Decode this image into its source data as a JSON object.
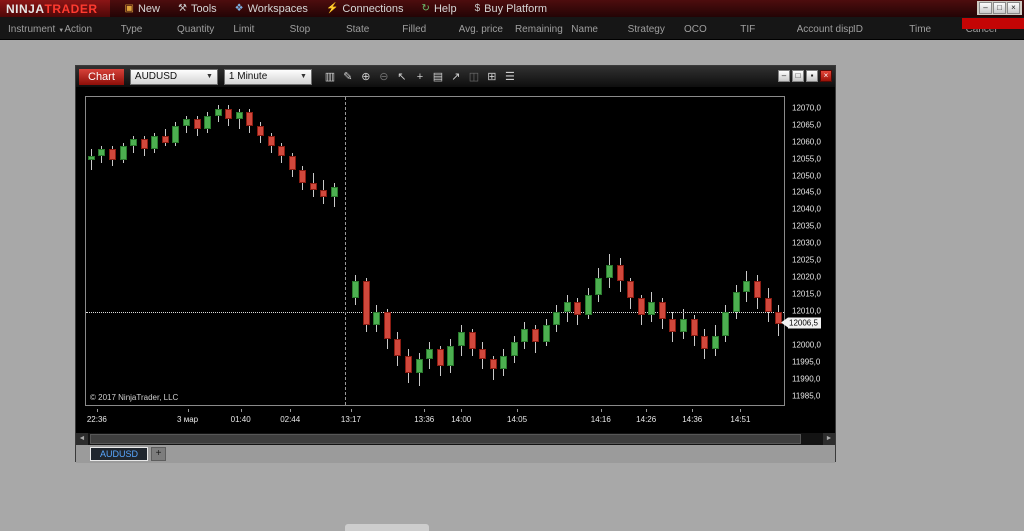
{
  "window": {
    "logo": {
      "part1": "NINJA",
      "part2": "TRADER"
    },
    "controls": [
      {
        "name": "window-minimize-button",
        "glyph": "–"
      },
      {
        "name": "window-restore-button",
        "glyph": "□"
      },
      {
        "name": "window-close-button",
        "glyph": "×"
      }
    ]
  },
  "menu_bar": {
    "items": [
      {
        "label": "New",
        "icon": "new-window-icon",
        "glyph": "▣",
        "color": "#e0a43c"
      },
      {
        "label": "Tools",
        "icon": "tools-icon",
        "glyph": "⚒",
        "color": "#c9c9c9"
      },
      {
        "label": "Workspaces",
        "icon": "workspaces-icon",
        "glyph": "❖",
        "color": "#7fb2e5"
      },
      {
        "label": "Connections",
        "icon": "connections-icon",
        "glyph": "⚡",
        "color": "#e05a4a"
      },
      {
        "label": "Help",
        "icon": "help-refresh-icon",
        "glyph": "↻",
        "color": "#6fc06f"
      },
      {
        "label": "Buy Platform",
        "icon": "dollar-icon",
        "glyph": "$",
        "color": "#c9c9c9"
      }
    ]
  },
  "order_grid": {
    "columns": [
      "Instrument",
      "Action",
      "Type",
      "Quantity",
      "Limit",
      "Stop",
      "State",
      "Filled",
      "Avg. price",
      "Remaining",
      "Name",
      "Strategy",
      "OCO",
      "TIF",
      "Account displ",
      "ID",
      "Time",
      "Cancel"
    ]
  },
  "chart_window": {
    "tab_label": "Chart",
    "instrument": "AUDUSD",
    "interval": "1 Minute",
    "toolbar": [
      {
        "name": "chart-style-icon",
        "glyph": "▥",
        "dim": false
      },
      {
        "name": "draw-tools-icon",
        "glyph": "✎",
        "dim": false
      },
      {
        "name": "zoom-in-icon",
        "glyph": "⊕",
        "dim": false
      },
      {
        "name": "zoom-out-icon",
        "glyph": "⊖",
        "dim": true
      },
      {
        "name": "cursor-icon",
        "glyph": "↖",
        "dim": false
      },
      {
        "name": "crosshair-icon",
        "glyph": "+",
        "dim": false
      },
      {
        "name": "data-box-icon",
        "glyph": "▤",
        "dim": false
      },
      {
        "name": "chart-trader-icon",
        "glyph": "↗",
        "dim": false
      },
      {
        "name": "drawing-panel-icon",
        "glyph": "◫",
        "dim": true
      },
      {
        "name": "properties-icon",
        "glyph": "⊞",
        "dim": false
      },
      {
        "name": "log-icon",
        "glyph": "☰",
        "dim": false
      }
    ],
    "controls": [
      {
        "name": "chart-minimize-button",
        "glyph": "–",
        "close": false
      },
      {
        "name": "chart-restore-button",
        "glyph": "□",
        "close": false
      },
      {
        "name": "chart-pin-button",
        "glyph": "▪",
        "close": false
      },
      {
        "name": "chart-close-button",
        "glyph": "×",
        "close": true
      }
    ],
    "scrollbar": {
      "left_arrow": "◄",
      "right_arrow": "►"
    },
    "copyright": "© 2017 NinjaTrader, LLC",
    "bottom_tab": "AUDUSD",
    "add_tab_label": "+"
  },
  "chart_data": {
    "type": "candlestick",
    "instrument": "AUDUSD",
    "interval": "1 Minute",
    "y_axis": {
      "min": 11982.5,
      "max": 12073.5,
      "tick_step": 5,
      "ticks": [
        12070,
        12065,
        12060,
        12055,
        12050,
        12045,
        12040,
        12035,
        12030,
        12025,
        12020,
        12015,
        12010,
        12000,
        11995,
        11990,
        11985
      ],
      "decimal_separator": ","
    },
    "last_price": 12006.5,
    "last_price_label": "12006,5",
    "dashed_price_line": 12010.0,
    "session_break_slot": 24,
    "x_labels": [
      {
        "label": "22:36",
        "pos": 0.017
      },
      {
        "label": "3 мар",
        "pos": 0.147
      },
      {
        "label": "01:40",
        "pos": 0.223
      },
      {
        "label": "02:44",
        "pos": 0.294
      },
      {
        "label": "13:17",
        "pos": 0.381
      },
      {
        "label": "13:36",
        "pos": 0.486
      },
      {
        "label": "14:00",
        "pos": 0.539
      },
      {
        "label": "14:05",
        "pos": 0.619
      },
      {
        "label": "14:16",
        "pos": 0.739
      },
      {
        "label": "14:26",
        "pos": 0.804
      },
      {
        "label": "14:36",
        "pos": 0.87
      },
      {
        "label": "14:51",
        "pos": 0.939
      }
    ],
    "candles": [
      [
        12055,
        12058,
        12052,
        12056
      ],
      [
        12056,
        12059,
        12054,
        12058
      ],
      [
        12058,
        12059,
        12053,
        12055
      ],
      [
        12055,
        12060,
        12054,
        12059
      ],
      [
        12059,
        12062,
        12057,
        12061
      ],
      [
        12061,
        12062,
        12056,
        12058
      ],
      [
        12058,
        12063,
        12057,
        12062
      ],
      [
        12062,
        12064,
        12059,
        12060
      ],
      [
        12060,
        12066,
        12059,
        12065
      ],
      [
        12065,
        12068,
        12063,
        12067
      ],
      [
        12067,
        12068,
        12062,
        12064
      ],
      [
        12064,
        12069,
        12063,
        12068
      ],
      [
        12068,
        12071,
        12066,
        12070
      ],
      [
        12070,
        12071,
        12065,
        12067
      ],
      [
        12067,
        12070,
        12064,
        12069
      ],
      [
        12069,
        12070,
        12063,
        12065
      ],
      [
        12065,
        12066,
        12060,
        12062
      ],
      [
        12062,
        12063,
        12057,
        12059
      ],
      [
        12059,
        12060,
        12054,
        12056
      ],
      [
        12056,
        12057,
        12050,
        12052
      ],
      [
        12052,
        12053,
        12046,
        12048
      ],
      [
        12048,
        12051,
        12044,
        12046
      ],
      [
        12046,
        12049,
        12042,
        12044
      ],
      [
        12044,
        12048,
        12041,
        12047
      ],
      [
        12014,
        12021,
        12012,
        12019
      ],
      [
        12019,
        12020,
        12004,
        12006
      ],
      [
        12006,
        12012,
        12004,
        12010
      ],
      [
        12010,
        12011,
        11999,
        12002
      ],
      [
        12002,
        12004,
        11994,
        11997
      ],
      [
        11997,
        11999,
        11989,
        11992
      ],
      [
        11992,
        11998,
        11988,
        11996
      ],
      [
        11996,
        12001,
        11993,
        11999
      ],
      [
        11999,
        12000,
        11991,
        11994
      ],
      [
        11994,
        12002,
        11992,
        12000
      ],
      [
        12000,
        12006,
        11997,
        12004
      ],
      [
        12004,
        12005,
        11997,
        11999
      ],
      [
        11999,
        12001,
        11993,
        11996
      ],
      [
        11996,
        11997,
        11990,
        11993
      ],
      [
        11993,
        11999,
        11991,
        11997
      ],
      [
        11997,
        12003,
        11995,
        12001
      ],
      [
        12001,
        12007,
        11999,
        12005
      ],
      [
        12005,
        12006,
        11998,
        12001
      ],
      [
        12001,
        12008,
        12000,
        12006
      ],
      [
        12006,
        12012,
        12004,
        12010
      ],
      [
        12010,
        12015,
        12007,
        12013
      ],
      [
        12013,
        12014,
        12006,
        12009
      ],
      [
        12009,
        12017,
        12008,
        12015
      ],
      [
        12015,
        12023,
        12013,
        12020
      ],
      [
        12020,
        12027,
        12017,
        12024
      ],
      [
        12024,
        12026,
        12016,
        12019
      ],
      [
        12019,
        12020,
        12011,
        12014
      ],
      [
        12014,
        12015,
        12006,
        12009
      ],
      [
        12009,
        12016,
        12007,
        12013
      ],
      [
        12013,
        12014,
        12005,
        12008
      ],
      [
        12008,
        12010,
        12001,
        12004
      ],
      [
        12004,
        12011,
        12002,
        12008
      ],
      [
        12008,
        12009,
        12000,
        12003
      ],
      [
        12003,
        12005,
        11996,
        11999
      ],
      [
        11999,
        12006,
        11997,
        12003
      ],
      [
        12003,
        12012,
        12001,
        12010
      ],
      [
        12010,
        12018,
        12008,
        12016
      ],
      [
        12016,
        12022,
        12013,
        12019
      ],
      [
        12019,
        12021,
        12011,
        12014
      ],
      [
        12014,
        12017,
        12007,
        12010
      ],
      [
        12010,
        12012,
        12003,
        12006.5
      ]
    ]
  },
  "colors": {
    "up_candle": "#4caf50",
    "up_border": "#2b7a2e",
    "down_candle": "#d1483c",
    "down_border": "#8c1d13",
    "wick": "#c9c9c9",
    "accent_red": "#c40505",
    "tab_blue": "#58a6ff"
  }
}
